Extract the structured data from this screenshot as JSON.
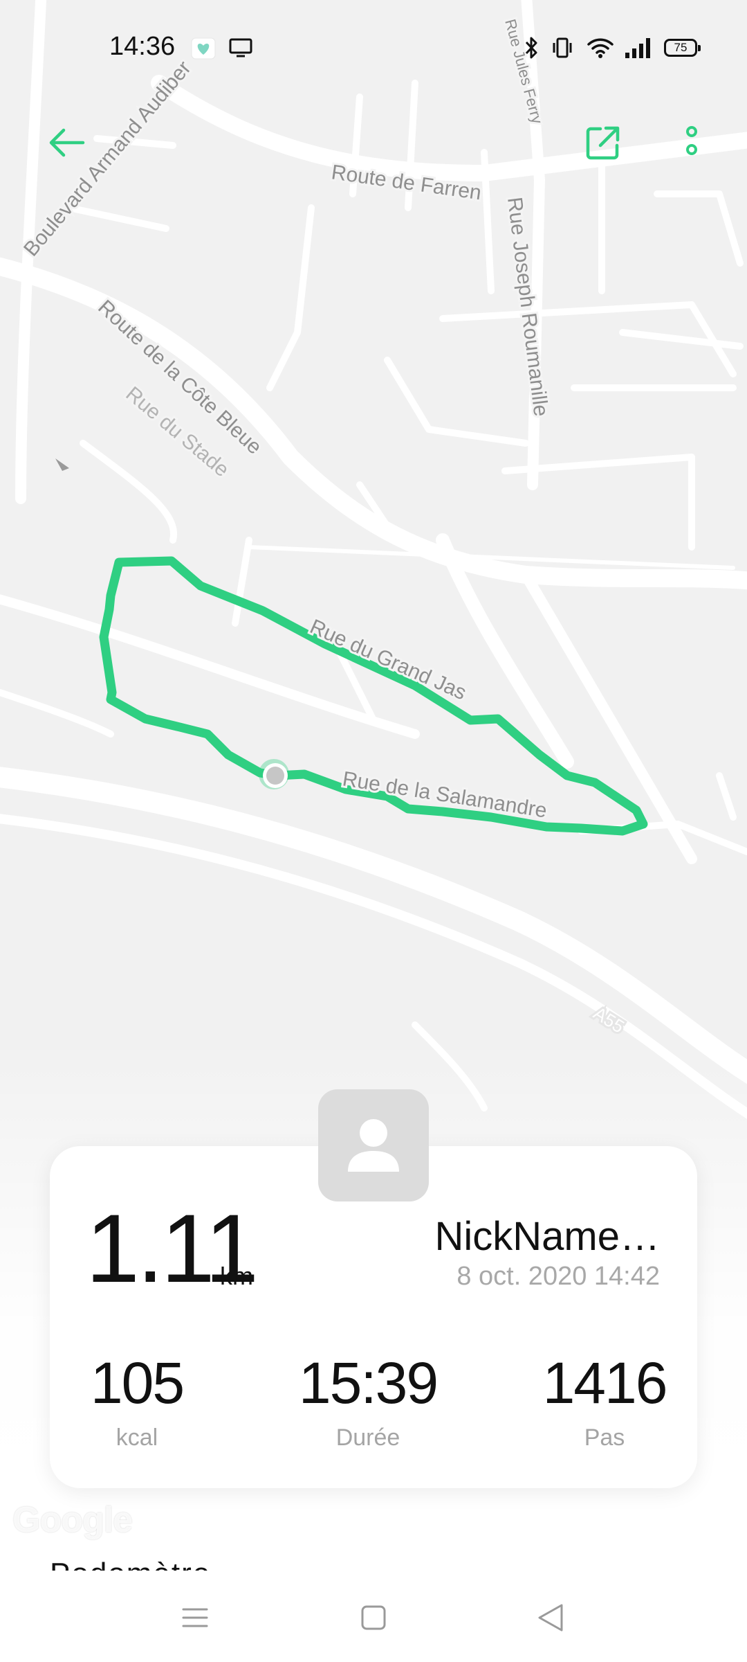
{
  "status_bar": {
    "time": "14:36",
    "battery": "75",
    "icons": [
      "health-app-icon",
      "screen-cast-icon",
      "bluetooth-icon",
      "vibrate-icon",
      "wifi-icon",
      "signal-icon",
      "battery-icon"
    ]
  },
  "toolbar": {
    "back_icon": "arrow-left-icon",
    "share_icon": "share-external-icon",
    "more_icon": "more-vertical-icon",
    "accent_color": "#2fcf82"
  },
  "map": {
    "streets": [
      "Boulevard Armand Audiber",
      "Rue Jules Ferry",
      "Route de Farren",
      "Rue Joseph Roumanille",
      "Route de la Côte Bleue",
      "Rue du Stade",
      "Rue du Grand Jas",
      "Rue de la Salamandre",
      "A55"
    ],
    "route_color": "#2fcf82",
    "attribution": "Google"
  },
  "summary": {
    "distance": "1.11",
    "distance_unit": "km",
    "nickname": "NickName…",
    "datetime": "8 oct. 2020 14:42",
    "stats": [
      {
        "value": "105",
        "label": "kcal"
      },
      {
        "value": "15:39",
        "label": "Durée"
      },
      {
        "value": "1416",
        "label": "Pas"
      }
    ]
  },
  "below_card": {
    "partial_text": "Podomètre"
  },
  "nav_bar": {
    "icons": [
      "menu-icon",
      "home-square-icon",
      "back-triangle-icon"
    ]
  }
}
